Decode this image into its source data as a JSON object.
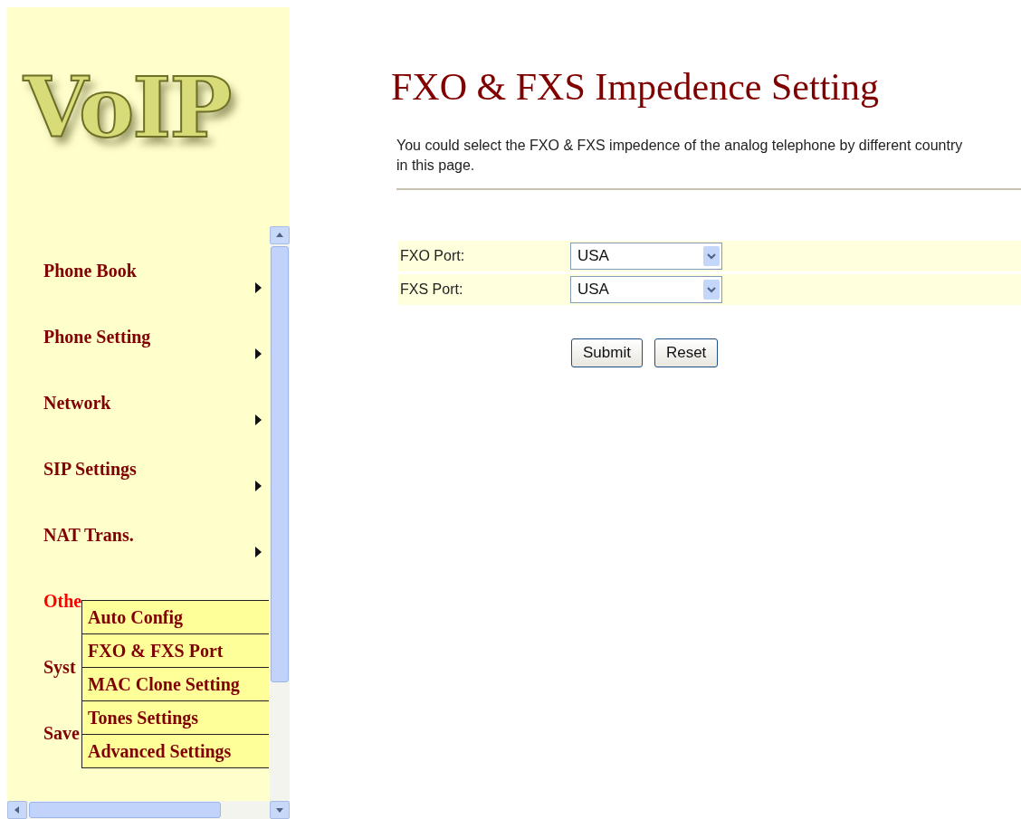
{
  "logo": {
    "text": "VoIP"
  },
  "sidebar": {
    "items": [
      {
        "label": "Phone Book",
        "selected": false,
        "has_submenu": true
      },
      {
        "label": "Phone Setting",
        "selected": false,
        "has_submenu": true
      },
      {
        "label": "Network",
        "selected": false,
        "has_submenu": true
      },
      {
        "label": "SIP Settings",
        "selected": false,
        "has_submenu": true
      },
      {
        "label": "NAT Trans.",
        "selected": false,
        "has_submenu": true
      },
      {
        "label": "Othe",
        "selected": true
      },
      {
        "label": "Syst",
        "selected": false
      },
      {
        "label": "Save",
        "selected": false
      }
    ],
    "submenu": {
      "items": [
        "Auto Config",
        "FXO & FXS Port",
        "MAC Clone Setting",
        "Tones Settings",
        "Advanced Settings"
      ]
    }
  },
  "page": {
    "title": "FXO & FXS Impedence Setting",
    "description": "You could select the FXO & FXS impedence of the analog telephone by different country in this page.",
    "fields": [
      {
        "label": "FXO Port:",
        "value": "USA"
      },
      {
        "label": "FXS Port:",
        "value": "USA"
      }
    ],
    "buttons": [
      "Submit",
      "Reset"
    ]
  }
}
